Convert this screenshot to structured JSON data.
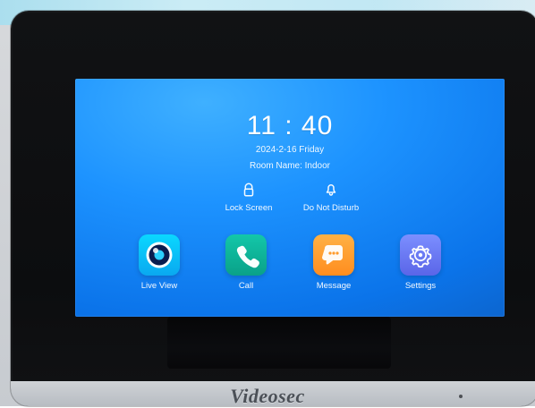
{
  "device": {
    "brand": "Videosec"
  },
  "screen": {
    "time": "11 : 40",
    "date": "2024-2-16 Friday",
    "room": "Room Name: Indoor"
  },
  "quick_actions": [
    {
      "label": "Lock Screen",
      "icon": "lock-icon"
    },
    {
      "label": "Do Not Disturb",
      "icon": "bell-icon"
    }
  ],
  "apps": [
    {
      "label": "Live View",
      "icon": "camera-icon"
    },
    {
      "label": "Call",
      "icon": "phone-icon"
    },
    {
      "label": "Message",
      "icon": "message-icon"
    },
    {
      "label": "Settings",
      "icon": "gear-icon"
    }
  ],
  "colors": {
    "screen_bg": "#1d93ff",
    "live_view": "#0aa8f0",
    "call": "#0aa188",
    "message": "#ff8d1f",
    "settings": "#5a65e8"
  }
}
